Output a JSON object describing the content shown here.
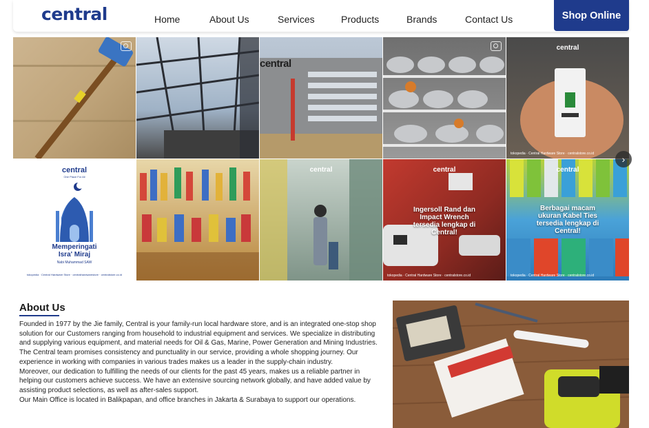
{
  "header": {
    "logo": "central",
    "nav": [
      "Home",
      "About Us",
      "Services",
      "Products",
      "Brands",
      "Contact Us"
    ],
    "shop_button": "Shop Online"
  },
  "gallery": {
    "tiles": [
      {
        "name": "hammer-on-boxes-photo"
      },
      {
        "name": "glass-roof-photo"
      },
      {
        "name": "central-building-photo",
        "sign": "central"
      },
      {
        "name": "cookware-shelves-photo"
      },
      {
        "name": "circuit-breaker-photo",
        "brand": "central",
        "footer": "tokopedia · Central Hardware Store · centralstore.co.id"
      },
      {
        "name": "isra-miraj-poster",
        "brand": "central",
        "tagline": "One Place For All",
        "headline_1": "Memperingati",
        "headline_2": "Isra' Miraj",
        "subline": "Nabi Muhammad SAW",
        "footer": "tokopedia · Central Hardware Store · centralhardwarestore · centralstore.co.id"
      },
      {
        "name": "paint-brushes-aisle-photo"
      },
      {
        "name": "store-aisle-customer-photo",
        "brand": "central"
      },
      {
        "name": "impact-wrench-promo",
        "brand": "central",
        "caption": "Ingersoll Rand dan Impact Wrench tersedia lengkap di Central!",
        "footer": "tokopedia · Central Hardware Store · centralstore.co.id"
      },
      {
        "name": "cable-ties-promo",
        "brand": "central",
        "caption": "Berbagai macam ukuran Kabel Ties tersedia lengkap di Central!",
        "footer": "tokopedia · Central Hardware Store · centralstore.co.id"
      }
    ],
    "next_arrow": "›"
  },
  "about": {
    "title": "About Us",
    "paragraphs": [
      "Founded in 1977 by the Jie family, Central is your family-run local hardware store, and is an integrated one-stop shop solution for our Customers ranging from household to industrial equipment and services. We specialize in distributing and supplying various equipment, and material needs for Oil & Gas, Marine, Power Generation and Mining Industries.",
      "The Central team promises consistency and punctuality in our service, providing a whole shopping journey. Our experience in working with companies in various trades makes us a leader in the supply-chain industry.",
      "Moreover, our dedication to fulfilling the needs of our clients for the past 45 years, makes us a reliable partner in helping our customers achieve success. We have an extensive sourcing network globally, and have added value by assisting product selections, as well as after-sales support.",
      "Our Main Office is located in Balikpapan, and office branches in Jakarta & Surabaya to support our operations."
    ]
  },
  "colors": {
    "brand": "#1f3b8c"
  }
}
